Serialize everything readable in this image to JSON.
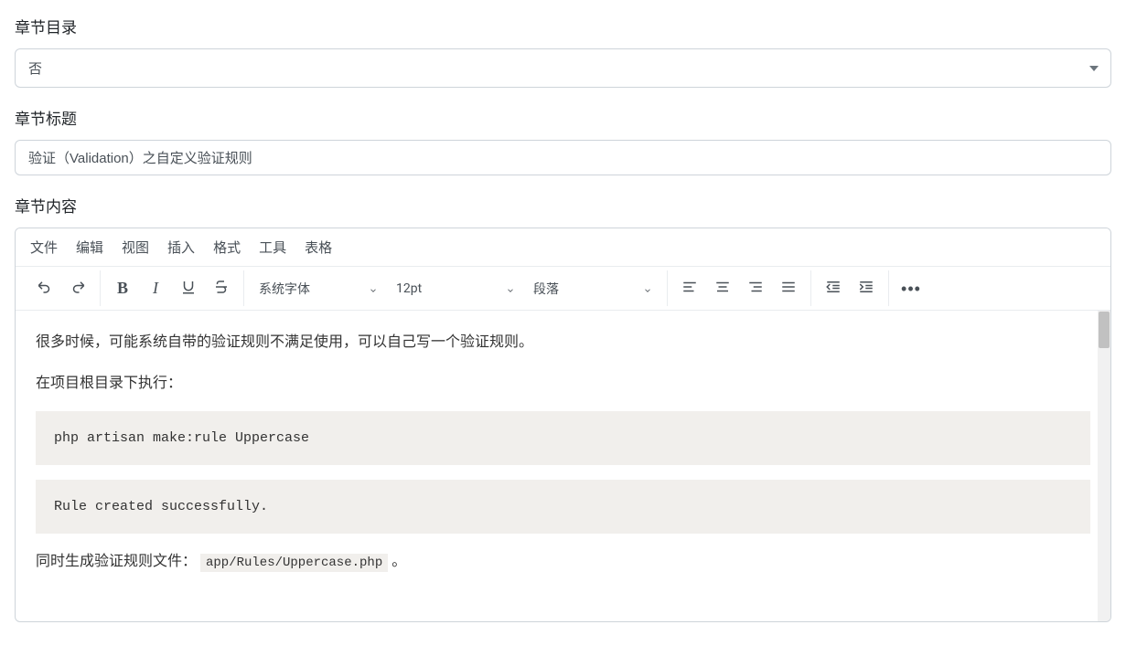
{
  "directory": {
    "label": "章节目录",
    "value": "否"
  },
  "title": {
    "label": "章节标题",
    "value": "验证（Validation）之自定义验证规则"
  },
  "content": {
    "label": "章节内容"
  },
  "menubar": {
    "file": "文件",
    "edit": "编辑",
    "view": "视图",
    "insert": "插入",
    "format": "格式",
    "tools": "工具",
    "table": "表格"
  },
  "toolbar": {
    "font_family": "系统字体",
    "font_size": "12pt",
    "block_format": "段落"
  },
  "editor_content": {
    "p1": "很多时候，可能系统自带的验证规则不满足使用，可以自己写一个验证规则。",
    "p2": "在项目根目录下执行：",
    "code1": "php artisan make:rule Uppercase",
    "code2": "Rule created successfully.",
    "p3_prefix": "同时生成验证规则文件：",
    "p3_code": "app/Rules/Uppercase.php",
    "p3_suffix": " 。"
  }
}
